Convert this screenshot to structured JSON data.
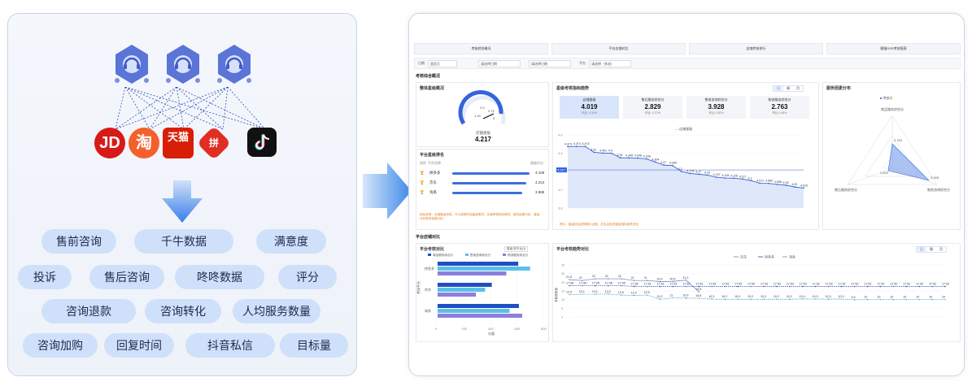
{
  "left": {
    "platforms": [
      "JD",
      "淘",
      "天猫",
      "拼",
      "抖音"
    ],
    "tags": [
      "售前咨询",
      "千牛数据",
      "满意度",
      "投诉",
      "售后咨询",
      "咚咚数据",
      "评分",
      "咨询退款",
      "咨询转化",
      "人均服务数量",
      "咨询加购",
      "回复时间",
      "抖音私信",
      "目标量"
    ]
  },
  "dashboard": {
    "tabs": [
      "考核综合概况",
      "平台店铺对比",
      "店铺考核排行",
      "客服DSR考核报表"
    ],
    "filters": {
      "date_label": "日期",
      "date_value": "固定天",
      "start_placeholder": "请选择日期",
      "end_placeholder": "请选择日期",
      "platform_label": "平台",
      "platform_value": "请选择（多选）"
    },
    "section1_title": "考核综合概况",
    "section2_title": "平台店铺对比",
    "overall": {
      "title": "整体星级概况",
      "gauge_label": "店铺星级",
      "gauge_value": "4.217",
      "ticks": [
        "1.25",
        "2.5",
        "3.75",
        "5"
      ]
    },
    "platform_rank": {
      "title": "平台星级排名",
      "col1": "排序",
      "col2": "平台名称",
      "col3": "星级评分",
      "rows": [
        {
          "name": "拼多多",
          "value": "4.439",
          "fill": 0.89
        },
        {
          "name": "京东",
          "value": "4.224",
          "fill": 0.85
        },
        {
          "name": "淘系",
          "value": "3.988",
          "fill": 0.8
        }
      ],
      "note": "指标说明：店铺星级考核，可以按照所选星级概况、店铺考核指标概况、服务因素分析、星级分析等多维度分析。"
    },
    "trend": {
      "title": "星级考核指标趋势",
      "seg": [
        "日",
        "周",
        "月"
      ],
      "kpis": [
        {
          "name": "店铺星级",
          "value": "4.019",
          "delta": "环比 -0.31%"
        },
        {
          "name": "售后服务综合分",
          "value": "2.829",
          "delta": "环比 -2.27%"
        },
        {
          "name": "售前咨询综合分",
          "value": "3.928",
          "delta": "环比 0.30%"
        },
        {
          "name": "物流服务综合分",
          "value": "2.763",
          "delta": "环比 0.48%"
        }
      ],
      "legend": "店铺星级",
      "ref": "4.217",
      "note": "提示：星级综合趋势展示近期，并包含各项星级指标趋势变化"
    },
    "radar": {
      "title": "服务因素分布",
      "legend": "考核分",
      "labels": [
        "商品服务综合分",
        "售前咨询综合分",
        "售后服务综合分"
      ],
      "values": [
        "2.763",
        "3.928",
        "2.829"
      ],
      "center": "0.502"
    },
    "compare": {
      "title": "平台考核对比",
      "legend": [
        "商品服务综合分",
        "售前咨询综合分",
        "物流服务综合分"
      ],
      "select": "星级 按平台(1)",
      "categories": [
        "拼多多",
        "京东",
        "淘系"
      ],
      "xaxis": [
        "0",
        "200",
        "400",
        "600",
        "800"
      ],
      "xlabel": "分量",
      "ylabel": "考核平台"
    },
    "trend2": {
      "title": "平台考核趋势对比",
      "seg": [
        "日",
        "周",
        "月"
      ],
      "legend": [
        "京东",
        "拼多多",
        "淘系"
      ],
      "ylabel": "考核趋势值"
    }
  },
  "chart_data": [
    {
      "type": "line",
      "title": "星级考核指标趋势",
      "series": [
        {
          "name": "店铺星级",
          "values": [
            4.473,
            4.474,
            4.474,
            4.41,
            4.401,
            4.4,
            4.35,
            4.348,
            4.346,
            4.338,
            4.304,
            4.27,
            4.265,
            4.2,
            4.178,
            4.17,
            4.16,
            4.137,
            4.128,
            4.126,
            4.117,
            4.1,
            4.071,
            4.069,
            4.058,
            4.05,
            4.03,
            4.019
          ]
        }
      ],
      "ylim": [
        3.8,
        4.6
      ]
    },
    {
      "type": "bar",
      "title": "平台考核对比",
      "categories": [
        "拼多多",
        "京东",
        "淘系"
      ],
      "series": [
        {
          "name": "商品服务综合分",
          "values": [
            610,
            410,
            615
          ]
        },
        {
          "name": "售前咨询综合分",
          "values": [
            700,
            360,
            545
          ]
        },
        {
          "name": "物流服务综合分",
          "values": [
            520,
            290,
            640
          ]
        }
      ],
      "xlim": [
        0,
        800
      ]
    },
    {
      "type": "line",
      "title": "平台考核趋势对比",
      "series": [
        {
          "name": "京东",
          "values": [
            21.5,
            21,
            22,
            22,
            22,
            21,
            21,
            20.4,
            20.5,
            21.2,
            14.5,
            null,
            null,
            null,
            null,
            null,
            null,
            null,
            null,
            null,
            null,
            null,
            null,
            null,
            null,
            null,
            null,
            null,
            null,
            null
          ]
        },
        {
          "name": "拼多多",
          "values": [
            17.98,
            17.96,
            17.95,
            17.96,
            17.95,
            17.65,
            17.51,
            17.51,
            17.52,
            17.52,
            17.53,
            17.53,
            17.53,
            17.53,
            17.54,
            17.53,
            17.52,
            17.53,
            17.53,
            17.53,
            17.53,
            17.52,
            17.52,
            17.52,
            17.52,
            17.52,
            17.52,
            17.52,
            17.52,
            17.53
          ]
        },
        {
          "name": "淘系",
          "values": [
            12.9,
            13.1,
            13.1,
            13.2,
            12.6,
            12.4,
            12.6,
            10.2,
            11,
            10.9,
            10.8,
            10.3,
            10.2,
            10.2,
            10.2,
            10.2,
            10.2,
            10.2,
            10.4,
            10.3,
            10.3,
            10.3,
            9.9,
            10,
            10,
            10,
            10,
            10,
            10,
            10
          ]
        }
      ],
      "ylim": [
        0,
        30
      ]
    }
  ]
}
